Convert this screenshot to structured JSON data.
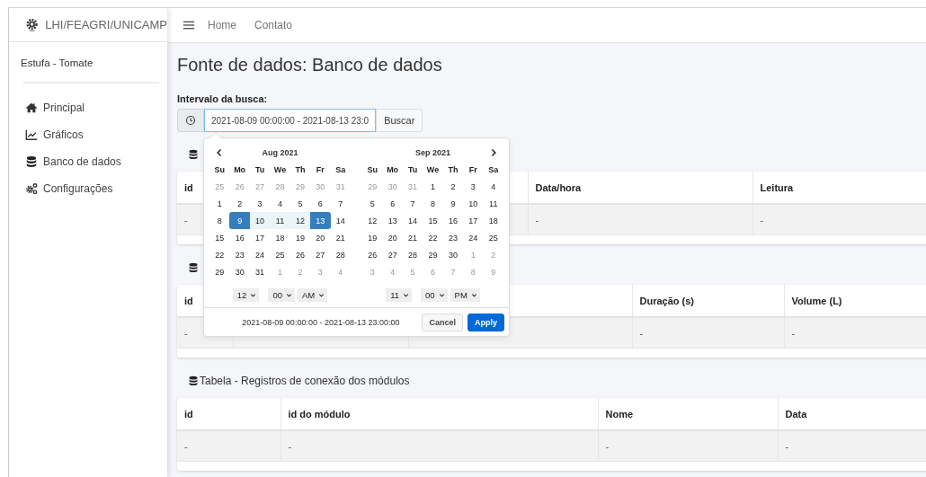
{
  "brand": {
    "title": "LHI/FEAGRI/UNICAMP"
  },
  "navbar": {
    "links": [
      "Home",
      "Contato"
    ]
  },
  "sidebar": {
    "subtitle": "Estufa - Tomate",
    "items": [
      {
        "label": "Principal"
      },
      {
        "label": "Gráficos"
      },
      {
        "label": "Banco de dados"
      },
      {
        "label": "Configurações"
      }
    ]
  },
  "page_title": "Fonte de dados: Banco de dados",
  "search": {
    "label": "Intervalo da busca:",
    "value": "2021-08-09 00:00:00 - 2021-08-13 23:0",
    "button": "Buscar"
  },
  "date_picker": {
    "months": [
      {
        "title": "Aug 2021",
        "weekdays": [
          "Su",
          "Mo",
          "Tu",
          "We",
          "Th",
          "Fr",
          "Sa"
        ],
        "weeks": [
          [
            {
              "day": "25",
              "other_month": true,
              "selected": false,
              "in_range": false
            },
            {
              "day": "26",
              "other_month": true,
              "selected": false,
              "in_range": false
            },
            {
              "day": "27",
              "other_month": true,
              "selected": false,
              "in_range": false
            },
            {
              "day": "28",
              "other_month": true,
              "selected": false,
              "in_range": false
            },
            {
              "day": "29",
              "other_month": true,
              "selected": false,
              "in_range": false
            },
            {
              "day": "30",
              "other_month": true,
              "selected": false,
              "in_range": false
            },
            {
              "day": "31",
              "other_month": true,
              "selected": false,
              "in_range": false
            }
          ],
          [
            {
              "day": "1",
              "other_month": false,
              "selected": false,
              "in_range": false
            },
            {
              "day": "2",
              "other_month": false,
              "selected": false,
              "in_range": false
            },
            {
              "day": "3",
              "other_month": false,
              "selected": false,
              "in_range": false
            },
            {
              "day": "4",
              "other_month": false,
              "selected": false,
              "in_range": false
            },
            {
              "day": "5",
              "other_month": false,
              "selected": false,
              "in_range": false
            },
            {
              "day": "6",
              "other_month": false,
              "selected": false,
              "in_range": false
            },
            {
              "day": "7",
              "other_month": false,
              "selected": false,
              "in_range": false
            }
          ],
          [
            {
              "day": "8",
              "other_month": false,
              "selected": false,
              "in_range": false
            },
            {
              "day": "9",
              "other_month": false,
              "selected": true,
              "in_range": true
            },
            {
              "day": "10",
              "other_month": false,
              "selected": false,
              "in_range": true
            },
            {
              "day": "11",
              "other_month": false,
              "selected": false,
              "in_range": true
            },
            {
              "day": "12",
              "other_month": false,
              "selected": false,
              "in_range": true
            },
            {
              "day": "13",
              "other_month": false,
              "selected": true,
              "in_range": true
            },
            {
              "day": "14",
              "other_month": false,
              "selected": false,
              "in_range": false
            }
          ],
          [
            {
              "day": "15",
              "other_month": false,
              "selected": false,
              "in_range": false
            },
            {
              "day": "16",
              "other_month": false,
              "selected": false,
              "in_range": false
            },
            {
              "day": "17",
              "other_month": false,
              "selected": false,
              "in_range": false
            },
            {
              "day": "18",
              "other_month": false,
              "selected": false,
              "in_range": false
            },
            {
              "day": "19",
              "other_month": false,
              "selected": false,
              "in_range": false
            },
            {
              "day": "20",
              "other_month": false,
              "selected": false,
              "in_range": false
            },
            {
              "day": "21",
              "other_month": false,
              "selected": false,
              "in_range": false
            }
          ],
          [
            {
              "day": "22",
              "other_month": false,
              "selected": false,
              "in_range": false
            },
            {
              "day": "23",
              "other_month": false,
              "selected": false,
              "in_range": false
            },
            {
              "day": "24",
              "other_month": false,
              "selected": false,
              "in_range": false
            },
            {
              "day": "25",
              "other_month": false,
              "selected": false,
              "in_range": false
            },
            {
              "day": "26",
              "other_month": false,
              "selected": false,
              "in_range": false
            },
            {
              "day": "27",
              "other_month": false,
              "selected": false,
              "in_range": false
            },
            {
              "day": "28",
              "other_month": false,
              "selected": false,
              "in_range": false
            }
          ],
          [
            {
              "day": "29",
              "other_month": false,
              "selected": false,
              "in_range": false
            },
            {
              "day": "30",
              "other_month": false,
              "selected": false,
              "in_range": false
            },
            {
              "day": "31",
              "other_month": false,
              "selected": false,
              "in_range": false
            },
            {
              "day": "1",
              "other_month": true,
              "selected": false,
              "in_range": false
            },
            {
              "day": "2",
              "other_month": true,
              "selected": false,
              "in_range": false
            },
            {
              "day": "3",
              "other_month": true,
              "selected": false,
              "in_range": false
            },
            {
              "day": "4",
              "other_month": true,
              "selected": false,
              "in_range": false
            }
          ]
        ]
      },
      {
        "title": "Sep 2021",
        "weekdays": [
          "Su",
          "Mo",
          "Tu",
          "We",
          "Th",
          "Fr",
          "Sa"
        ],
        "weeks": [
          [
            {
              "day": "29",
              "other_month": true,
              "selected": false,
              "in_range": false
            },
            {
              "day": "30",
              "other_month": true,
              "selected": false,
              "in_range": false
            },
            {
              "day": "31",
              "other_month": true,
              "selected": false,
              "in_range": false
            },
            {
              "day": "1",
              "other_month": false,
              "selected": false,
              "in_range": false
            },
            {
              "day": "2",
              "other_month": false,
              "selected": false,
              "in_range": false
            },
            {
              "day": "3",
              "other_month": false,
              "selected": false,
              "in_range": false
            },
            {
              "day": "4",
              "other_month": false,
              "selected": false,
              "in_range": false
            }
          ],
          [
            {
              "day": "5",
              "other_month": false,
              "selected": false,
              "in_range": false
            },
            {
              "day": "6",
              "other_month": false,
              "selected": false,
              "in_range": false
            },
            {
              "day": "7",
              "other_month": false,
              "selected": false,
              "in_range": false
            },
            {
              "day": "8",
              "other_month": false,
              "selected": false,
              "in_range": false
            },
            {
              "day": "9",
              "other_month": false,
              "selected": false,
              "in_range": false
            },
            {
              "day": "10",
              "other_month": false,
              "selected": false,
              "in_range": false
            },
            {
              "day": "11",
              "other_month": false,
              "selected": false,
              "in_range": false
            }
          ],
          [
            {
              "day": "12",
              "other_month": false,
              "selected": false,
              "in_range": false
            },
            {
              "day": "13",
              "other_month": false,
              "selected": false,
              "in_range": false
            },
            {
              "day": "14",
              "other_month": false,
              "selected": false,
              "in_range": false
            },
            {
              "day": "15",
              "other_month": false,
              "selected": false,
              "in_range": false
            },
            {
              "day": "16",
              "other_month": false,
              "selected": false,
              "in_range": false
            },
            {
              "day": "17",
              "other_month": false,
              "selected": false,
              "in_range": false
            },
            {
              "day": "18",
              "other_month": false,
              "selected": false,
              "in_range": false
            }
          ],
          [
            {
              "day": "19",
              "other_month": false,
              "selected": false,
              "in_range": false
            },
            {
              "day": "20",
              "other_month": false,
              "selected": false,
              "in_range": false
            },
            {
              "day": "21",
              "other_month": false,
              "selected": false,
              "in_range": false
            },
            {
              "day": "22",
              "other_month": false,
              "selected": false,
              "in_range": false
            },
            {
              "day": "23",
              "other_month": false,
              "selected": false,
              "in_range": false
            },
            {
              "day": "24",
              "other_month": false,
              "selected": false,
              "in_range": false
            },
            {
              "day": "25",
              "other_month": false,
              "selected": false,
              "in_range": false
            }
          ],
          [
            {
              "day": "26",
              "other_month": false,
              "selected": false,
              "in_range": false
            },
            {
              "day": "27",
              "other_month": false,
              "selected": false,
              "in_range": false
            },
            {
              "day": "28",
              "other_month": false,
              "selected": false,
              "in_range": false
            },
            {
              "day": "29",
              "other_month": false,
              "selected": false,
              "in_range": false
            },
            {
              "day": "30",
              "other_month": false,
              "selected": false,
              "in_range": false
            },
            {
              "day": "1",
              "other_month": true,
              "selected": false,
              "in_range": false
            },
            {
              "day": "2",
              "other_month": true,
              "selected": false,
              "in_range": false
            }
          ],
          [
            {
              "day": "3",
              "other_month": true,
              "selected": false,
              "in_range": false
            },
            {
              "day": "4",
              "other_month": true,
              "selected": false,
              "in_range": false
            },
            {
              "day": "5",
              "other_month": true,
              "selected": false,
              "in_range": false
            },
            {
              "day": "6",
              "other_month": true,
              "selected": false,
              "in_range": false
            },
            {
              "day": "7",
              "other_month": true,
              "selected": false,
              "in_range": false
            },
            {
              "day": "8",
              "other_month": true,
              "selected": false,
              "in_range": false
            },
            {
              "day": "9",
              "other_month": true,
              "selected": false,
              "in_range": false
            }
          ]
        ]
      }
    ],
    "times": [
      {
        "hour": "12",
        "minute": "00",
        "ampm": "AM"
      },
      {
        "hour": "11",
        "minute": "00",
        "ampm": "PM"
      }
    ],
    "range_text": "2021-08-09 00:00:00 - 2021-08-13 23:00:00",
    "buttons": [
      {
        "label": "Cancel",
        "kind": "default"
      },
      {
        "label": "Apply",
        "kind": "primary"
      }
    ]
  },
  "tables": [
    {
      "columns": [
        "id",
        null,
        "Data/hora",
        "Leitura"
      ],
      "rows": [
        [
          "-",
          null,
          "-",
          "-"
        ]
      ]
    },
    {
      "columns": [
        "id",
        null,
        null,
        "Duração (s)",
        "Volume (L)"
      ],
      "rows": [
        [
          "-",
          null,
          null,
          "-",
          "-"
        ]
      ]
    },
    {
      "title": "Tabela - Registros de conexão dos módulos",
      "columns": [
        "id",
        "id do módulo",
        "Nome",
        "Data"
      ],
      "rows": [
        [
          "-",
          "-",
          "-",
          "-"
        ]
      ]
    }
  ]
}
